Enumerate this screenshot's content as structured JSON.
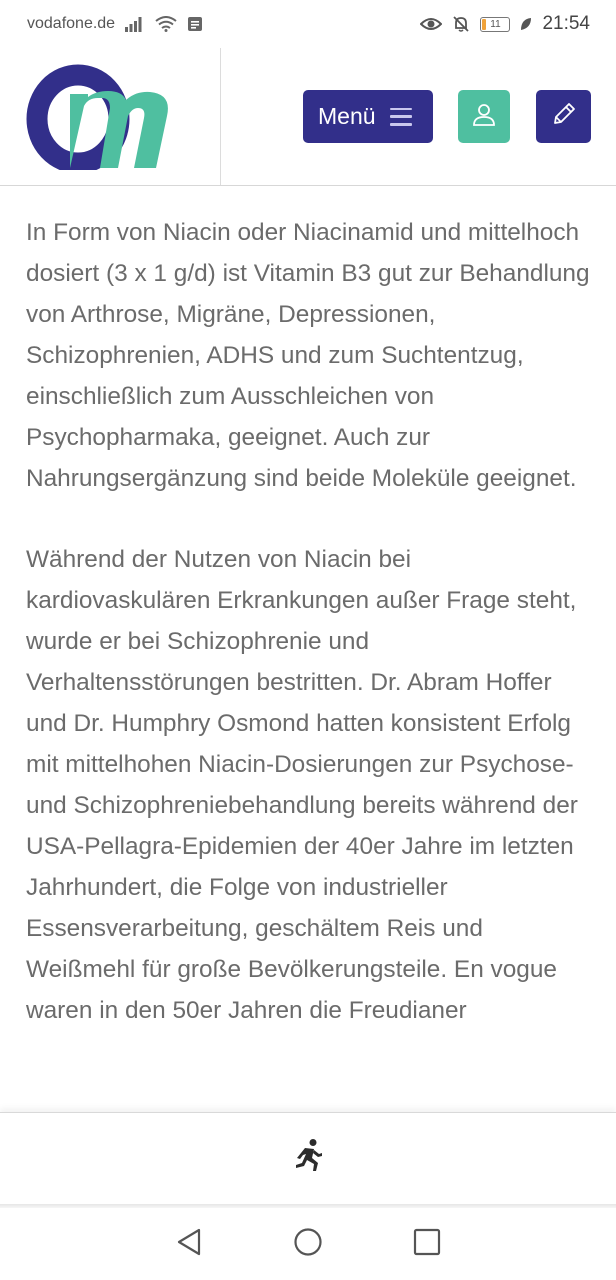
{
  "status_bar": {
    "carrier": "vodafone.de",
    "battery_level": "11",
    "time": "21:54",
    "icons": [
      "signal-icon",
      "wifi-icon",
      "message-icon",
      "eye-icon",
      "mute-bell-icon",
      "battery-icon",
      "leaf-icon"
    ]
  },
  "header": {
    "logo_text": "Om",
    "menu_label": "Menü",
    "colors": {
      "primary": "#322f8a",
      "accent": "#4fbfa0"
    }
  },
  "article": {
    "paragraphs": [
      "In Form von Niacin oder Niacinamid und mittelhoch dosiert (3 x 1 g/d) ist Vitamin B3 gut zur Behandlung von Arthrose, Migräne, Depressionen, Schizophrenien, ADHS und zum Suchtentzug, einschließlich zum Ausschleichen von Psychopharmaka, geeignet. Auch zur Nahrungsergänzung sind beide Moleküle geeignet.",
      "Während der Nutzen von Niacin bei kardiovaskulären Erkrankungen außer Frage steht, wurde er bei Schizophrenie und Verhaltensstörungen bestritten. Dr. Abram Hoffer und Dr. Humphry Osmond hatten konsistent Erfolg mit mittelhohen Niacin-Dosierungen zur Psychose- und Schizophreniebehandlung bereits während der USA-Pellagra-Epidemien der 40er Jahre im letzten Jahrhundert, die Folge von industrieller Essensverarbeitung, geschältem Reis und Weißmehl für große Bevölkerungsteile. En vogue waren in den 50er Jahren die Freudianer"
    ]
  },
  "bottom_bar": {
    "icon": "running-person-icon"
  },
  "nav_bar": {
    "icons": [
      "back-icon",
      "home-icon",
      "recents-icon"
    ]
  }
}
